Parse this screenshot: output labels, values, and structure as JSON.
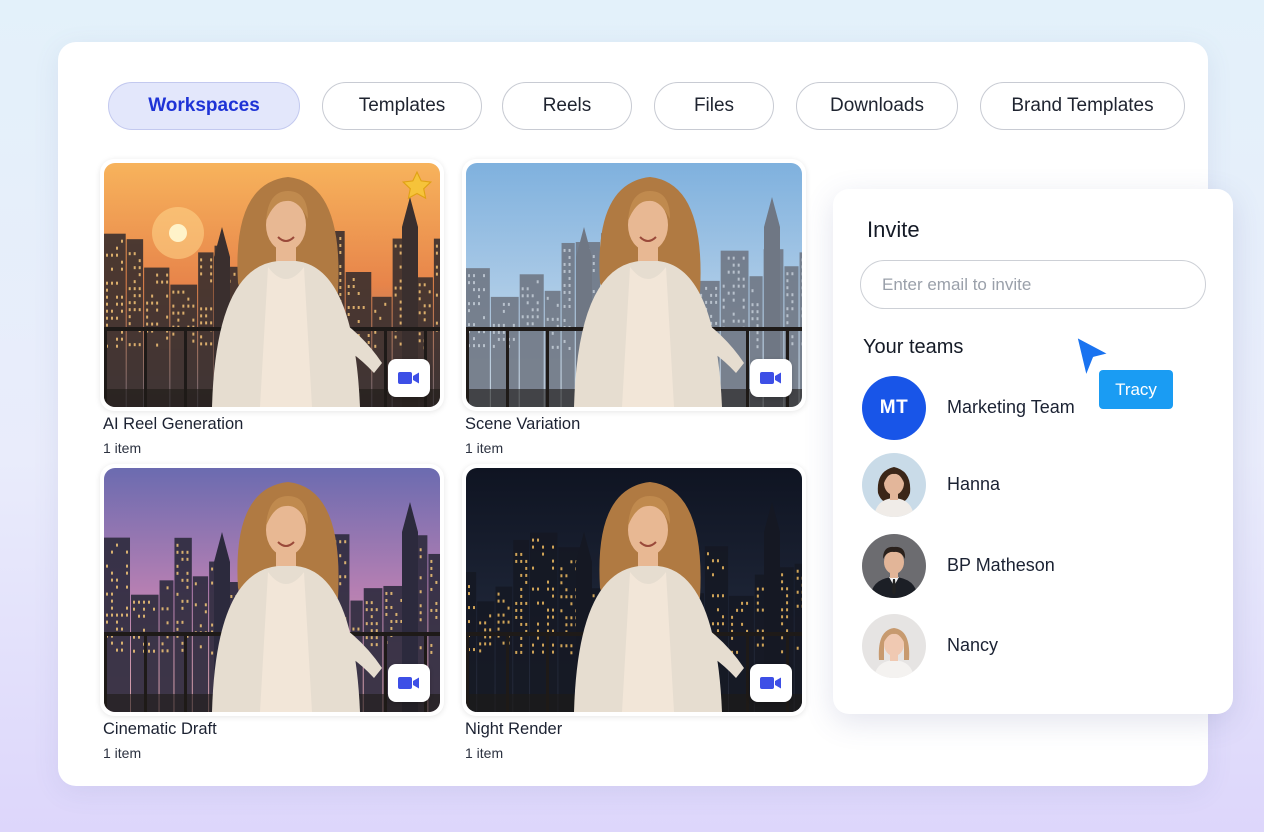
{
  "tabs": [
    {
      "label": "Workspaces",
      "active": true
    },
    {
      "label": "Templates",
      "active": false
    },
    {
      "label": "Reels",
      "active": false
    },
    {
      "label": "Files",
      "active": false
    },
    {
      "label": "Downloads",
      "active": false
    },
    {
      "label": "Brand Templates",
      "active": false
    }
  ],
  "workspaces": [
    {
      "title": "AI Reel Generation",
      "subtitle": "1 item",
      "starred": true,
      "badge_icon": "video-camera-icon",
      "scene": "sunset"
    },
    {
      "title": "Scene Variation",
      "subtitle": "1 item",
      "starred": false,
      "badge_icon": "video-camera-icon",
      "scene": "day"
    },
    {
      "title": "Cinematic Draft",
      "subtitle": "1 item",
      "starred": false,
      "badge_icon": "video-camera-icon",
      "scene": "dusk"
    },
    {
      "title": "Night Render",
      "subtitle": "1 item",
      "starred": false,
      "badge_icon": "video-camera-icon",
      "scene": "night"
    }
  ],
  "invite": {
    "title": "Invite",
    "email_placeholder": "Enter email to invite",
    "teams_title": "Your teams",
    "members": [
      {
        "name": "Marketing Team",
        "initials": "MT"
      },
      {
        "name": "Hanna"
      },
      {
        "name": "BP Matheson"
      },
      {
        "name": "Nancy"
      }
    ]
  },
  "cursor_label": "Tracy",
  "colors": {
    "accent": "#1e33d6",
    "active_tab_bg": "#e3e7fb",
    "team_avatar": "#1855e8",
    "cursor": "#1a73f0",
    "cursor_tag": "#1a9cf3",
    "video_icon": "#3d4fe6",
    "star": "#f6c33a"
  }
}
